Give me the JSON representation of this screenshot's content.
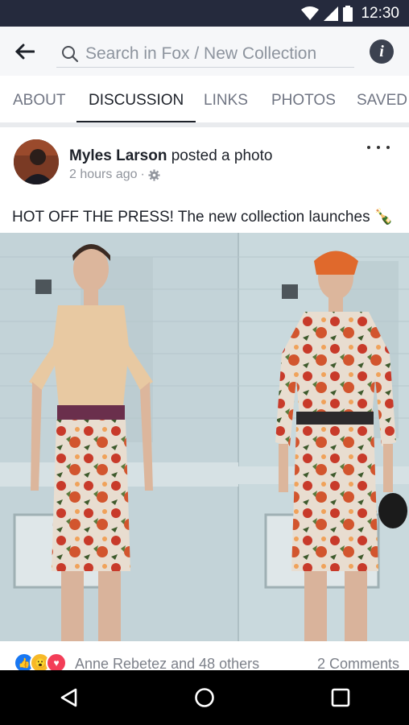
{
  "status_bar": {
    "time": "12:30",
    "icons": [
      "wifi-icon",
      "signal-icon",
      "battery-icon"
    ]
  },
  "header": {
    "back_icon": "arrow-left-icon",
    "search_placeholder": "Search in Fox / New Collection",
    "info_icon": "info-icon"
  },
  "tabs": [
    {
      "label": "ABOUT",
      "active": false
    },
    {
      "label": "DISCUSSION",
      "active": true
    },
    {
      "label": "LINKS",
      "active": false
    },
    {
      "label": "PHOTOS",
      "active": false
    },
    {
      "label": "SAVED",
      "active": false
    }
  ],
  "post": {
    "author": "Myles Larson",
    "action": "posted a photo",
    "timestamp": "2 hours ago",
    "text": "HOT OFF THE PRESS! The new collection launches",
    "text_emoji": "🍾",
    "reactions": {
      "icons": [
        "like-icon",
        "wow-icon",
        "love-icon"
      ],
      "names": "Anne Rebetez and 48 others"
    },
    "comments": "2 Comments"
  },
  "colors": {
    "status_bar": "#252a3d",
    "header_bg": "#f6f7f9",
    "text_primary": "#1d2129",
    "text_secondary": "#90949c",
    "like_blue": "#1877f2",
    "love_red": "#f33e58",
    "wow_yellow": "#f7b928"
  },
  "nav": {
    "icons": [
      "back-triangle-icon",
      "home-circle-icon",
      "recents-square-icon"
    ]
  }
}
